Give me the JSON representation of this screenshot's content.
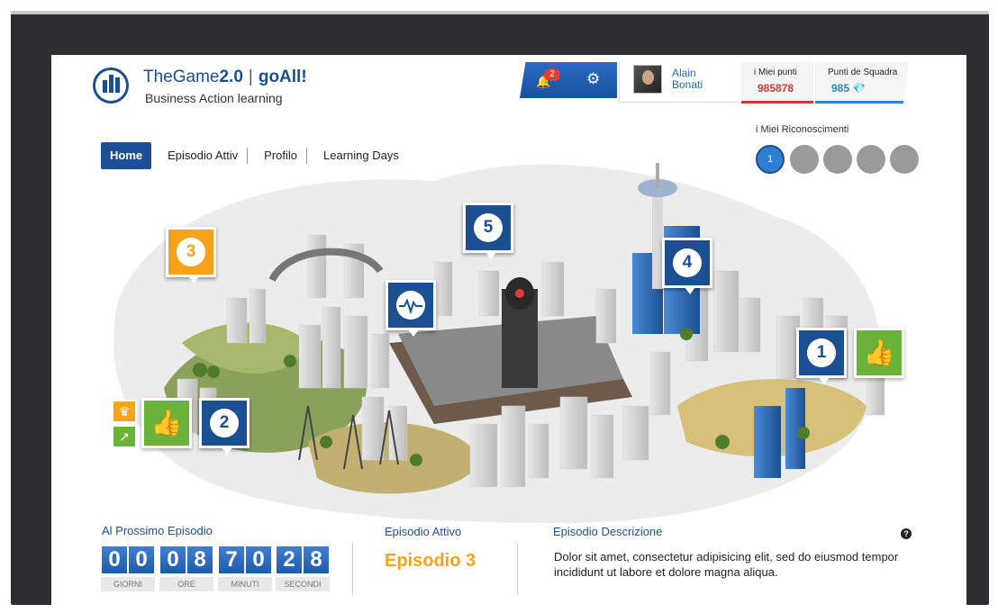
{
  "header": {
    "brand_name": "TheGame",
    "brand_version": "2.0",
    "brand_separator": "|",
    "brand_partner": "goAll!",
    "subtitle": "Business Action learning",
    "notifications_count": "2",
    "user": {
      "first_name": "Alain",
      "last_name": "Bonati"
    },
    "my_points": {
      "label": "i Miei punti",
      "value": "985878"
    },
    "team_points": {
      "label": "Punti de Squadra",
      "value": "985"
    }
  },
  "nav": {
    "items": [
      "Home",
      "Episodio Attiv",
      "Profilo",
      "Learning Days"
    ],
    "active": "Home"
  },
  "recognitions": {
    "title": "i Miei Riconoscimenti",
    "earned_badge_text": "1",
    "badges_total": 5,
    "badges_earned": 1
  },
  "city_map": {
    "markers": [
      "1",
      "2",
      "3",
      "4",
      "5"
    ],
    "colors": {
      "primary": "#1c4f91",
      "orange": "#f5a31a",
      "green": "#6ab23a"
    }
  },
  "countdown": {
    "title": "Al Prossimo Episodio",
    "digits": [
      "0",
      "0",
      "0",
      "8",
      "7",
      "0",
      "2",
      "8"
    ],
    "units": [
      "GIORNI",
      "ORE",
      "MINUTI",
      "SECONDI"
    ]
  },
  "active_episode": {
    "title": "Episodio Attivo",
    "value": "Episodio 3"
  },
  "description": {
    "title": "Episodio Descrizione",
    "text": "Dolor sit amet, consectetur adipisicing elit, sed do eiusmod tempor incididunt ut labore et dolore magna aliqua.",
    "help_label": "?"
  }
}
